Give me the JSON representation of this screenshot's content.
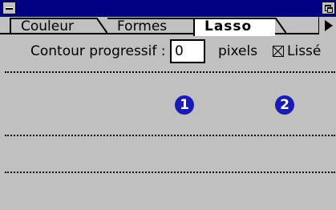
{
  "tabs": [
    {
      "label": "Couleur"
    },
    {
      "label": "Formes"
    },
    {
      "label": "Lasso"
    }
  ],
  "options": {
    "feather_label": "Contour progressif :",
    "feather_value": "0",
    "feather_unit": "pixels",
    "smooth_label": "Lissé",
    "smooth_checked": true
  },
  "callouts": {
    "first": "1",
    "second": "2"
  },
  "colors": {
    "titlebar": "#000080",
    "panel": "#c0c0c0",
    "callout": "#1a1ab4"
  }
}
